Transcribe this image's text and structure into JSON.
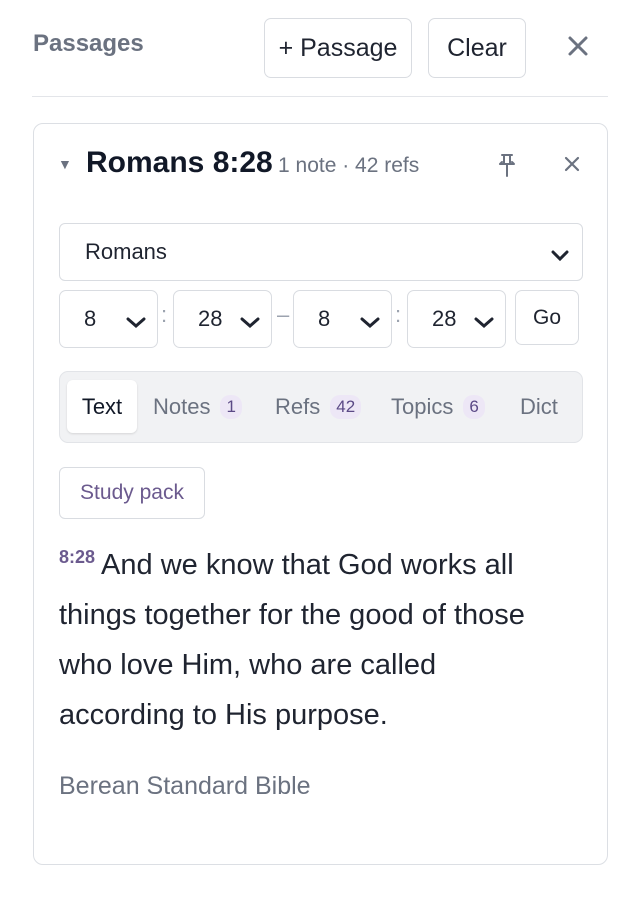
{
  "header": {
    "title": "Passages",
    "add_label": "+ Passage",
    "clear_label": "Clear"
  },
  "card": {
    "title": "Romans 8:28",
    "meta": "1 note · 42 refs",
    "book": "Romans",
    "range": {
      "start_chapter": "8",
      "start_verse": "28",
      "end_chapter": "8",
      "end_verse": "28",
      "colon": ":",
      "dash": "–"
    },
    "go_label": "Go",
    "tabs": [
      {
        "label": "Text",
        "count": ""
      },
      {
        "label": "Notes",
        "count": "1"
      },
      {
        "label": "Refs",
        "count": "42"
      },
      {
        "label": "Topics",
        "count": "6"
      },
      {
        "label": "Dict",
        "count": ""
      }
    ],
    "active_tab": "Text",
    "study_pack_label": "Study pack",
    "verse_number": "8:28",
    "verse_text": "And we know that God works all things together for the good of those who love Him, who are called according to His purpose.",
    "translation": "Berean Standard Bible"
  },
  "colors": {
    "accent": "#6b5a8e",
    "badge_bg": "#ede7f6",
    "border": "#d9dce1",
    "muted_text": "#6b7280"
  },
  "icons": {
    "collapse": "caret-down-icon",
    "pin": "pin-icon",
    "close": "close-icon",
    "dropdown": "chevron-down-icon"
  }
}
